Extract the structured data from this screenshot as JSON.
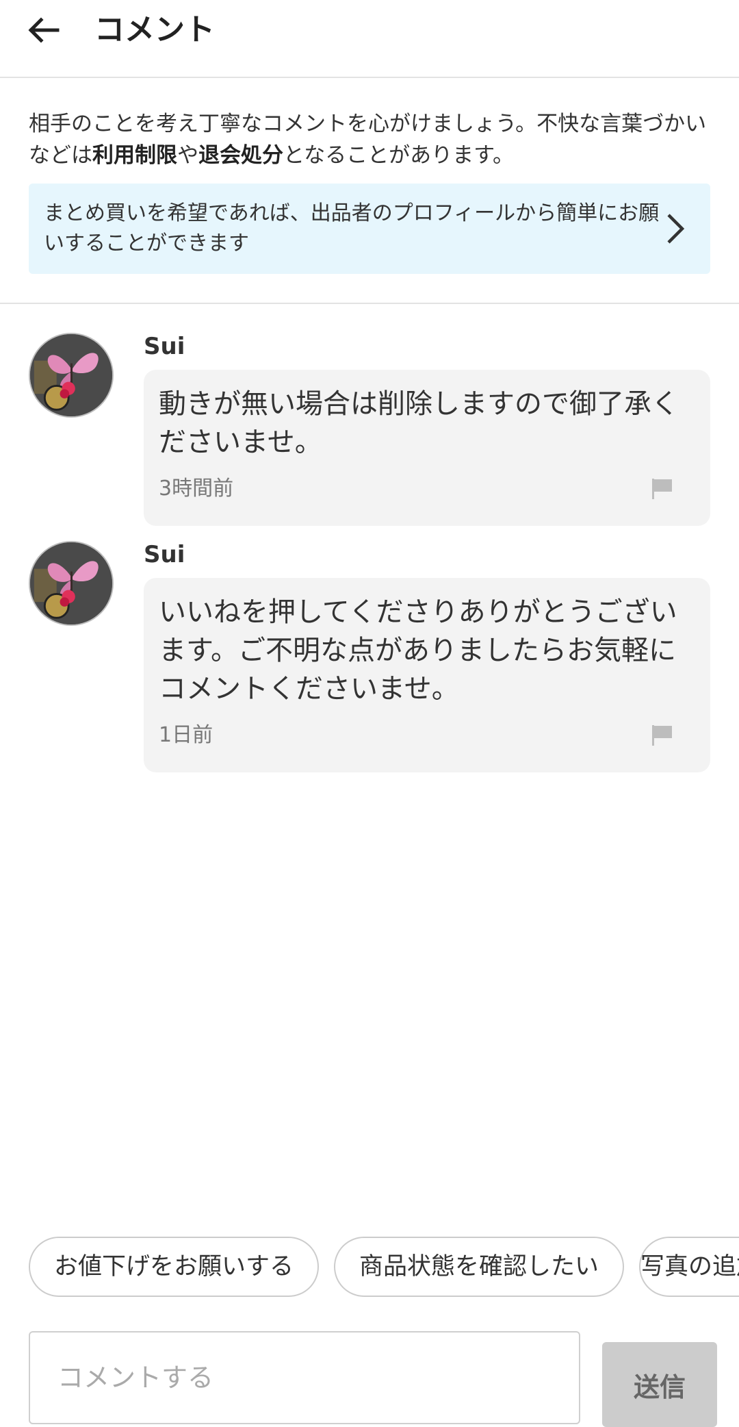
{
  "header": {
    "title": "コメント",
    "back_icon": "arrow-left-icon"
  },
  "notice": {
    "text_1": "相手のことを考え丁寧なコメントを心がけましょう。不快な言葉づかいなどは",
    "bold_1": "利用制限",
    "text_2": "や",
    "bold_2": "退会処分",
    "text_3": "となることがあります。"
  },
  "banner": {
    "text": "まとめ買いを希望であれば、出品者のプロフィールから簡単にお願いすることができます",
    "icon": "chevron-right-icon",
    "background": "#e6f6fd"
  },
  "comments": [
    {
      "user": "Sui",
      "text": "動きが無い場合は削除しますので御了承くださいませ。",
      "time": "3時間前",
      "icon": "flag-icon"
    },
    {
      "user": "Sui",
      "text": "いいねを押してくださりありがとうございます。ご不明な点がありましたらお気軽にコメントくださいませ。",
      "time": "1日前",
      "icon": "flag-icon"
    }
  ],
  "quick_replies": [
    "お値下げをお願いする",
    "商品状態を確認したい",
    "写真の追加をお願いしたい"
  ],
  "input": {
    "placeholder": "コメントする",
    "value": ""
  },
  "send_button": {
    "label": "送信",
    "background": "#cccccc"
  }
}
